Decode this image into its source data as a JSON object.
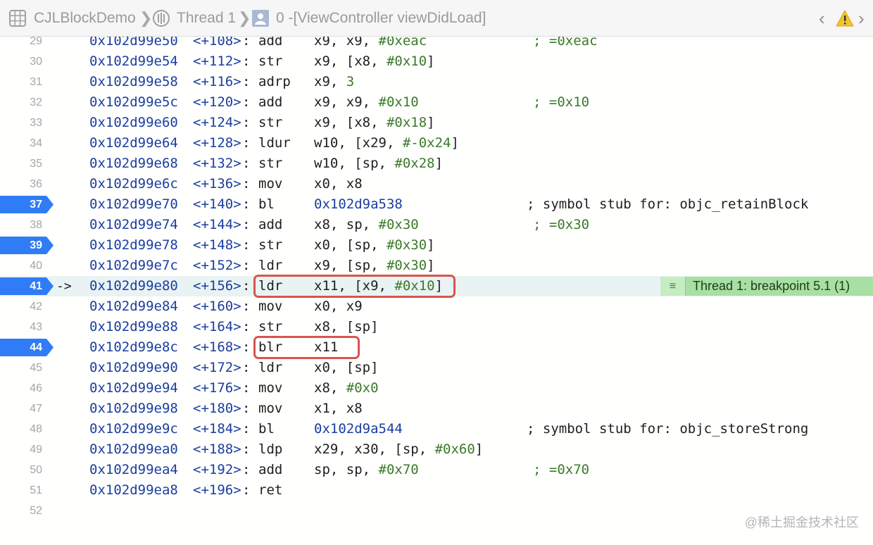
{
  "jumpbar": {
    "project": "CJLBlockDemo",
    "thread": "Thread 1",
    "frame": "0 -[ViewController viewDidLoad]"
  },
  "colors": {
    "breakpoint": "#2f7cf6",
    "current_line": "#e9f3f3",
    "highlight_box": "#d9534f",
    "breakpoint_label": "#a8dfa3"
  },
  "current_line_marker": "->",
  "breakpoint_label": "Thread 1: breakpoint 5.1 (1)",
  "watermark": "@稀土掘金技术社区",
  "lines": [
    {
      "n": "29",
      "addr": "0x102d99e50",
      "off": "<+108>",
      "mn": "add",
      "ops": "x9, x9, #0xeac",
      "cmt": "; =0xeac"
    },
    {
      "n": "30",
      "addr": "0x102d99e54",
      "off": "<+112>",
      "mn": "str",
      "ops": "x9, [x8, #0x10]",
      "cmt": ""
    },
    {
      "n": "31",
      "addr": "0x102d99e58",
      "off": "<+116>",
      "mn": "adrp",
      "ops": "x9, 3",
      "cmt": ""
    },
    {
      "n": "32",
      "addr": "0x102d99e5c",
      "off": "<+120>",
      "mn": "add",
      "ops": "x9, x9, #0x10",
      "cmt": "; =0x10"
    },
    {
      "n": "33",
      "addr": "0x102d99e60",
      "off": "<+124>",
      "mn": "str",
      "ops": "x9, [x8, #0x18]",
      "cmt": ""
    },
    {
      "n": "34",
      "addr": "0x102d99e64",
      "off": "<+128>",
      "mn": "ldur",
      "ops": "w10, [x29, #-0x24]",
      "cmt": ""
    },
    {
      "n": "35",
      "addr": "0x102d99e68",
      "off": "<+132>",
      "mn": "str",
      "ops": "w10, [sp, #0x28]",
      "cmt": ""
    },
    {
      "n": "36",
      "addr": "0x102d99e6c",
      "off": "<+136>",
      "mn": "mov",
      "ops": "x0, x8",
      "cmt": ""
    },
    {
      "n": "37",
      "addr": "0x102d99e70",
      "off": "<+140>",
      "mn": "bl",
      "ops": "0x102d9a538",
      "cmt": "; symbol stub for: objc_retainBlock",
      "bp": true
    },
    {
      "n": "38",
      "addr": "0x102d99e74",
      "off": "<+144>",
      "mn": "add",
      "ops": "x8, sp, #0x30",
      "cmt": "; =0x30"
    },
    {
      "n": "39",
      "addr": "0x102d99e78",
      "off": "<+148>",
      "mn": "str",
      "ops": "x0, [sp, #0x30]",
      "cmt": "",
      "bp": true
    },
    {
      "n": "40",
      "addr": "0x102d99e7c",
      "off": "<+152>",
      "mn": "ldr",
      "ops": "x9, [sp, #0x30]",
      "cmt": ""
    },
    {
      "n": "41",
      "addr": "0x102d99e80",
      "off": "<+156>",
      "mn": "ldr",
      "ops": "x11, [x9, #0x10]",
      "cmt": "",
      "bp": true,
      "current": true
    },
    {
      "n": "42",
      "addr": "0x102d99e84",
      "off": "<+160>",
      "mn": "mov",
      "ops": "x0, x9",
      "cmt": ""
    },
    {
      "n": "43",
      "addr": "0x102d99e88",
      "off": "<+164>",
      "mn": "str",
      "ops": "x8, [sp]",
      "cmt": ""
    },
    {
      "n": "44",
      "addr": "0x102d99e8c",
      "off": "<+168>",
      "mn": "blr",
      "ops": "x11",
      "cmt": "",
      "bp": true
    },
    {
      "n": "45",
      "addr": "0x102d99e90",
      "off": "<+172>",
      "mn": "ldr",
      "ops": "x0, [sp]",
      "cmt": ""
    },
    {
      "n": "46",
      "addr": "0x102d99e94",
      "off": "<+176>",
      "mn": "mov",
      "ops": "x8, #0x0",
      "cmt": ""
    },
    {
      "n": "47",
      "addr": "0x102d99e98",
      "off": "<+180>",
      "mn": "mov",
      "ops": "x1, x8",
      "cmt": ""
    },
    {
      "n": "48",
      "addr": "0x102d99e9c",
      "off": "<+184>",
      "mn": "bl",
      "ops": "0x102d9a544",
      "cmt": "; symbol stub for: objc_storeStrong"
    },
    {
      "n": "49",
      "addr": "0x102d99ea0",
      "off": "<+188>",
      "mn": "ldp",
      "ops": "x29, x30, [sp, #0x60]",
      "cmt": ""
    },
    {
      "n": "50",
      "addr": "0x102d99ea4",
      "off": "<+192>",
      "mn": "add",
      "ops": "sp, sp, #0x70",
      "cmt": "; =0x70"
    },
    {
      "n": "51",
      "addr": "0x102d99ea8",
      "off": "<+196>",
      "mn": "ret",
      "ops": "",
      "cmt": ""
    },
    {
      "n": "52",
      "addr": "",
      "off": "",
      "mn": "",
      "ops": "",
      "cmt": ""
    }
  ]
}
